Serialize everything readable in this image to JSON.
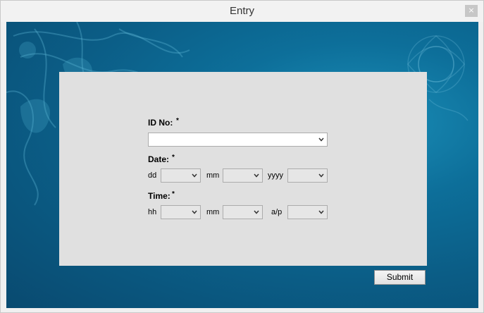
{
  "window": {
    "title": "Entry",
    "close_glyph": "×"
  },
  "form": {
    "id_label": "ID No:",
    "required_mark": "*",
    "id_value": "",
    "date_label": "Date:",
    "date_fields": {
      "dd": "dd",
      "mm": "mm",
      "yyyy": "yyyy"
    },
    "time_label": "Time:",
    "time_fields": {
      "hh": "hh",
      "mm": "mm",
      "ap": "a/p"
    }
  },
  "buttons": {
    "submit": "Submit"
  },
  "icons": {
    "close": "close-icon",
    "dropdown": "chevron-down-icon"
  },
  "colors": {
    "background": "#0b5d86",
    "panel": "#e0e0e0",
    "titlebar": "#f2f2f2"
  }
}
